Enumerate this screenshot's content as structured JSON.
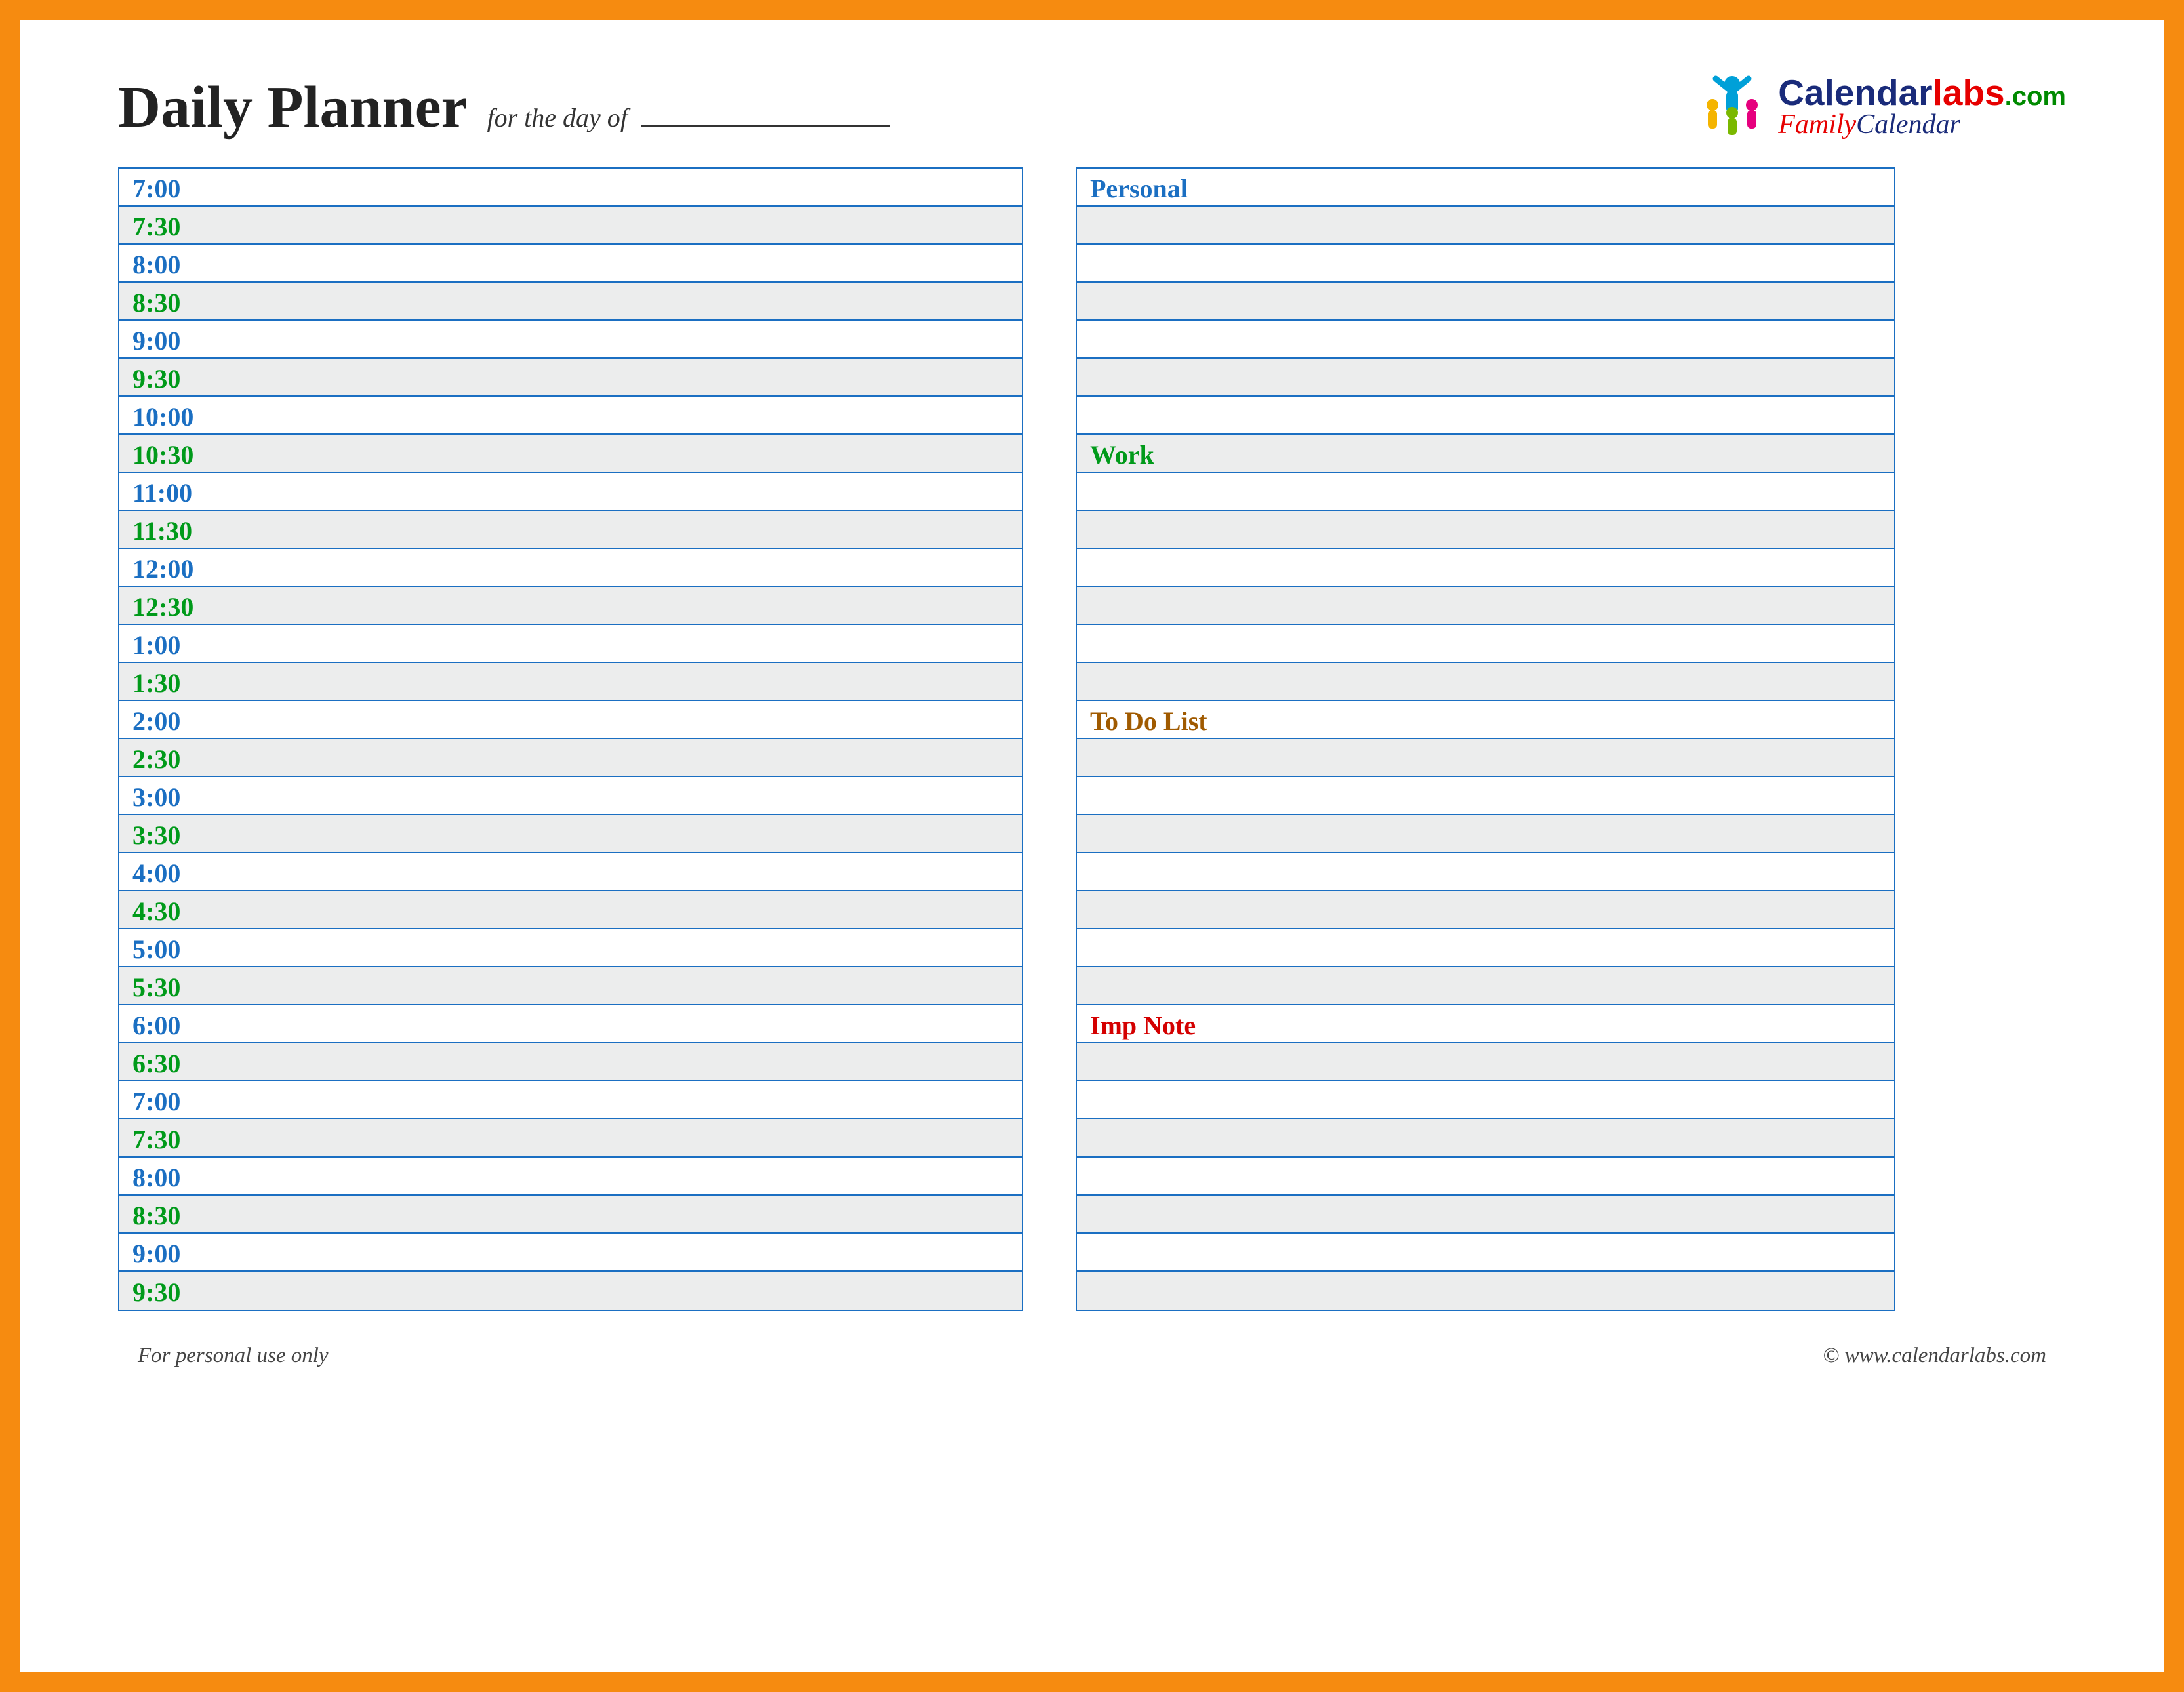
{
  "header": {
    "title": "Daily Planner",
    "subtitle": "for the day of"
  },
  "logo": {
    "cal": "Calendar",
    "labs": "labs",
    "com": ".com",
    "line2a": "Family",
    "line2b": "Calendar"
  },
  "schedule": [
    {
      "label": "7:00",
      "color": "blue",
      "shaded": false
    },
    {
      "label": "7:30",
      "color": "green",
      "shaded": true
    },
    {
      "label": "8:00",
      "color": "blue",
      "shaded": false
    },
    {
      "label": "8:30",
      "color": "green",
      "shaded": true
    },
    {
      "label": "9:00",
      "color": "blue",
      "shaded": false
    },
    {
      "label": "9:30",
      "color": "green",
      "shaded": true
    },
    {
      "label": "10:00",
      "color": "blue",
      "shaded": false
    },
    {
      "label": "10:30",
      "color": "green",
      "shaded": true
    },
    {
      "label": "11:00",
      "color": "blue",
      "shaded": false
    },
    {
      "label": "11:30",
      "color": "green",
      "shaded": true
    },
    {
      "label": "12:00",
      "color": "blue",
      "shaded": false
    },
    {
      "label": "12:30",
      "color": "green",
      "shaded": true
    },
    {
      "label": "1:00",
      "color": "blue",
      "shaded": false
    },
    {
      "label": "1:30",
      "color": "green",
      "shaded": true
    },
    {
      "label": "2:00",
      "color": "blue",
      "shaded": false
    },
    {
      "label": "2:30",
      "color": "green",
      "shaded": true
    },
    {
      "label": "3:00",
      "color": "blue",
      "shaded": false
    },
    {
      "label": "3:30",
      "color": "green",
      "shaded": true
    },
    {
      "label": "4:00",
      "color": "blue",
      "shaded": false
    },
    {
      "label": "4:30",
      "color": "green",
      "shaded": true
    },
    {
      "label": "5:00",
      "color": "blue",
      "shaded": false
    },
    {
      "label": "5:30",
      "color": "green",
      "shaded": true
    },
    {
      "label": "6:00",
      "color": "blue",
      "shaded": false
    },
    {
      "label": "6:30",
      "color": "green",
      "shaded": true
    },
    {
      "label": "7:00",
      "color": "blue",
      "shaded": false
    },
    {
      "label": "7:30",
      "color": "green",
      "shaded": true
    },
    {
      "label": "8:00",
      "color": "blue",
      "shaded": false
    },
    {
      "label": "8:30",
      "color": "green",
      "shaded": true
    },
    {
      "label": "9:00",
      "color": "blue",
      "shaded": false
    },
    {
      "label": "9:30",
      "color": "green",
      "shaded": true
    }
  ],
  "sidebar": [
    {
      "label": "Personal",
      "color": "blue",
      "shaded": false
    },
    {
      "label": "",
      "shaded": true
    },
    {
      "label": "",
      "shaded": false
    },
    {
      "label": "",
      "shaded": true
    },
    {
      "label": "",
      "shaded": false
    },
    {
      "label": "",
      "shaded": true
    },
    {
      "label": "",
      "shaded": false
    },
    {
      "label": "Work",
      "color": "green",
      "shaded": true
    },
    {
      "label": "",
      "shaded": false
    },
    {
      "label": "",
      "shaded": true
    },
    {
      "label": "",
      "shaded": false
    },
    {
      "label": "",
      "shaded": true
    },
    {
      "label": "",
      "shaded": false
    },
    {
      "label": "",
      "shaded": true
    },
    {
      "label": "To Do List",
      "color": "brown",
      "shaded": false
    },
    {
      "label": "",
      "shaded": true
    },
    {
      "label": "",
      "shaded": false
    },
    {
      "label": "",
      "shaded": true
    },
    {
      "label": "",
      "shaded": false
    },
    {
      "label": "",
      "shaded": true
    },
    {
      "label": "",
      "shaded": false
    },
    {
      "label": "",
      "shaded": true
    },
    {
      "label": "Imp Note",
      "color": "red",
      "shaded": false
    },
    {
      "label": "",
      "shaded": true
    },
    {
      "label": "",
      "shaded": false
    },
    {
      "label": "",
      "shaded": true
    },
    {
      "label": "",
      "shaded": false
    },
    {
      "label": "",
      "shaded": true
    },
    {
      "label": "",
      "shaded": false
    },
    {
      "label": "",
      "shaded": true
    }
  ],
  "footer": {
    "left": "For personal use only",
    "right": "© www.calendarlabs.com"
  }
}
